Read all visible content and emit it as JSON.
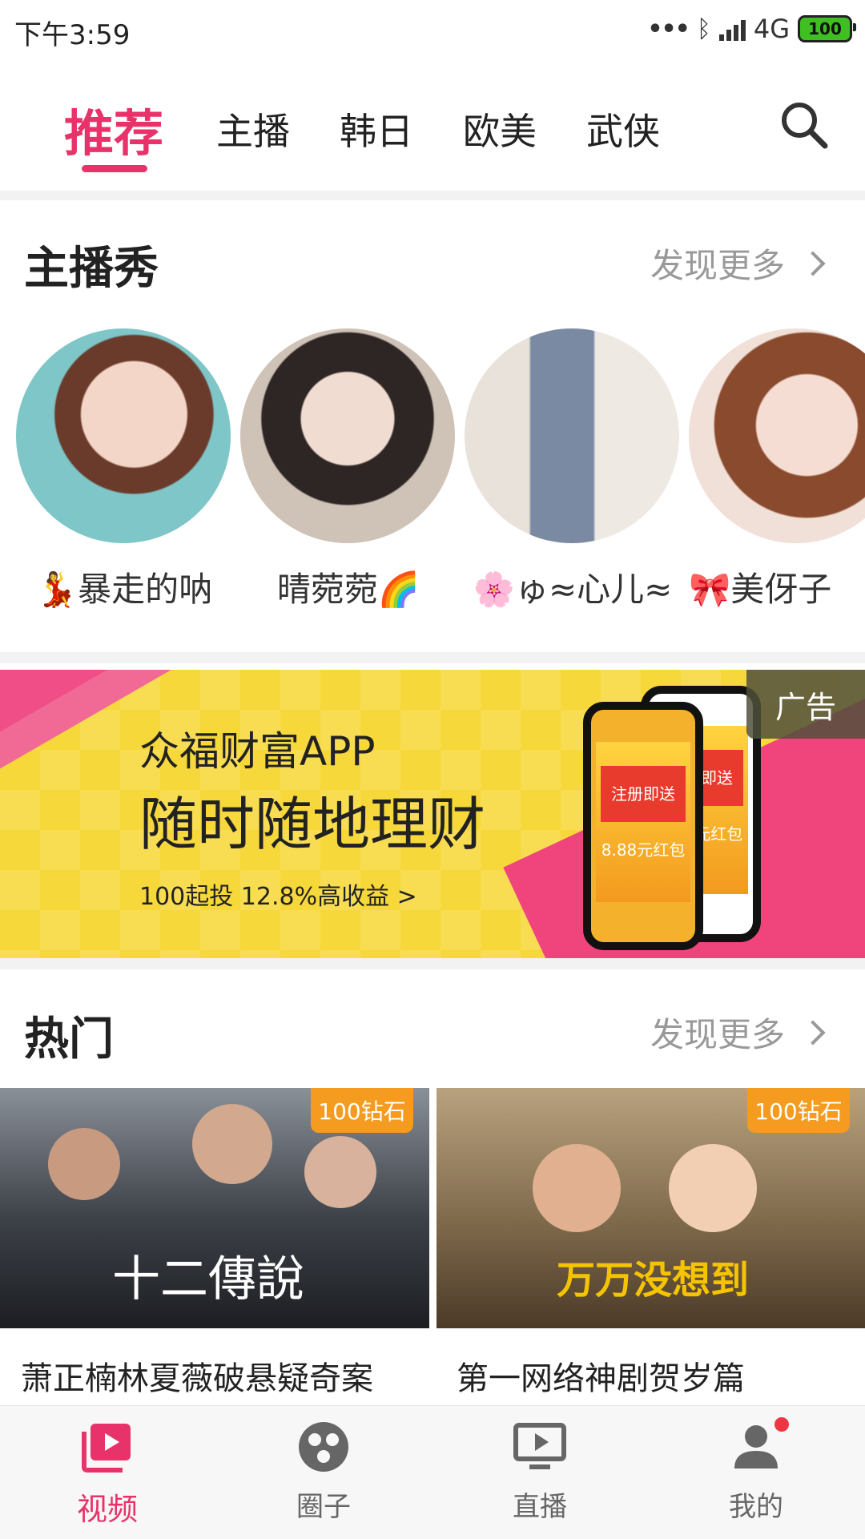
{
  "status_bar": {
    "time": "下午3:59",
    "network": "4G",
    "battery": "100"
  },
  "tabs": [
    {
      "label": "推荐",
      "active": true
    },
    {
      "label": "主播",
      "active": false
    },
    {
      "label": "韩日",
      "active": false
    },
    {
      "label": "欧美",
      "active": false
    },
    {
      "label": "武侠",
      "active": false
    }
  ],
  "anchor_section": {
    "title": "主播秀",
    "more_label": "发现更多",
    "anchors": [
      {
        "emoji": "💃",
        "name": "暴走的呐"
      },
      {
        "emoji": "🌈",
        "name": "晴菀菀"
      },
      {
        "emoji": "🌸",
        "name": "ゅ≈心儿≈"
      },
      {
        "emoji": "🎀",
        "name": "美伢子"
      }
    ]
  },
  "ad": {
    "label": "广告",
    "line1": "众福财富APP",
    "line2": "随时随地理财",
    "line3": "100起投    12.8%高收益     >",
    "phone_card_1": "注册即送 8.88元红包",
    "phone_card_2": "注册即送 8.88元红包"
  },
  "hot_section": {
    "title": "热门",
    "more_label": "发现更多",
    "videos": [
      {
        "badge": "100钻石",
        "poster_text": "十二傳說",
        "title": "萧正楠林夏薇破悬疑奇案"
      },
      {
        "badge": "100钻石",
        "poster_text": "万万没想到",
        "title": "第一网络神剧贺岁篇"
      }
    ]
  },
  "bottom_nav": [
    {
      "label": "视频",
      "icon": "video-icon",
      "active": true
    },
    {
      "label": "圈子",
      "icon": "circle-icon",
      "active": false
    },
    {
      "label": "直播",
      "icon": "tv-icon",
      "active": false
    },
    {
      "label": "我的",
      "icon": "user-icon",
      "active": false
    }
  ],
  "colors": {
    "accent": "#e8336a",
    "badge": "#f59b1f"
  }
}
